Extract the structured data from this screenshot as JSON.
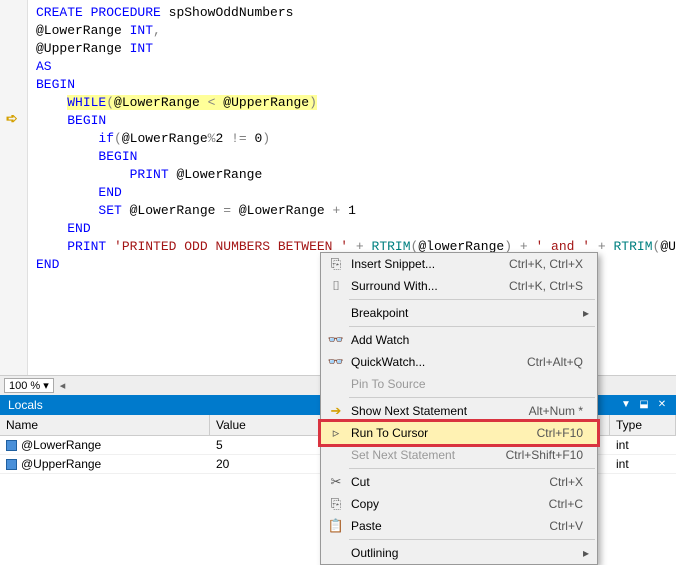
{
  "code": {
    "l1a": "CREATE",
    "l1b": "PROCEDURE",
    "l1c": " spShowOddNumbers",
    "l2a": "@LowerRange ",
    "l2b": "INT",
    "l2c": ",",
    "l3a": "@UpperRange ",
    "l3b": "INT",
    "l4": "AS",
    "l5": "BEGIN",
    "l6a": "WHILE",
    "l6b": "(",
    "l6c": "@LowerRange ",
    "l6d": "<",
    "l6e": " @UpperRange",
    "l6f": ")",
    "l7": "BEGIN",
    "l8a": "if",
    "l8b": "(",
    "l8c": "@LowerRange",
    "l8d": "%",
    "l8e": "2 ",
    "l8f": "!=",
    "l8g": " 0",
    "l8h": ")",
    "l9": "BEGIN",
    "l10a": "PRINT",
    "l10b": " @LowerRange",
    "l11": "END",
    "l12a": "SET",
    "l12b": " @LowerRange ",
    "l12c": "=",
    "l12d": " @LowerRange ",
    "l12e": "+",
    "l12f": " 1",
    "l13": "END",
    "l14a": "PRINT",
    "l14b": "'PRINTED ODD NUMBERS BETWEEN '",
    "l14c": "+",
    "l14d": "RTRIM",
    "l14e": "(",
    "l14f": "@lowerRange",
    "l14g": ")",
    "l14h": "+",
    "l14i": "' and '",
    "l14j": "+",
    "l14k": "RTRIM",
    "l14l": "(",
    "l14m": "@UpperRange",
    "l15": "END"
  },
  "zoom": "100 %",
  "locals": {
    "title": "Locals",
    "headers": {
      "name": "Name",
      "value": "Value",
      "type": "Type"
    },
    "rows": [
      {
        "name": "@LowerRange",
        "value": "5",
        "type": "int"
      },
      {
        "name": "@UpperRange",
        "value": "20",
        "type": "int"
      }
    ]
  },
  "menu": {
    "insert_snippet": "Insert Snippet...",
    "insert_snippet_sc": "Ctrl+K, Ctrl+X",
    "surround_with": "Surround With...",
    "surround_with_sc": "Ctrl+K, Ctrl+S",
    "breakpoint": "Breakpoint",
    "add_watch": "Add Watch",
    "quickwatch": "QuickWatch...",
    "quickwatch_sc": "Ctrl+Alt+Q",
    "pin_to_source": "Pin To Source",
    "show_next": "Show Next Statement",
    "show_next_sc": "Alt+Num *",
    "run_to_cursor": "Run To Cursor",
    "run_to_cursor_sc": "Ctrl+F10",
    "set_next": "Set Next Statement",
    "set_next_sc": "Ctrl+Shift+F10",
    "cut": "Cut",
    "cut_sc": "Ctrl+X",
    "copy": "Copy",
    "copy_sc": "Ctrl+C",
    "paste": "Paste",
    "paste_sc": "Ctrl+V",
    "outlining": "Outlining"
  }
}
